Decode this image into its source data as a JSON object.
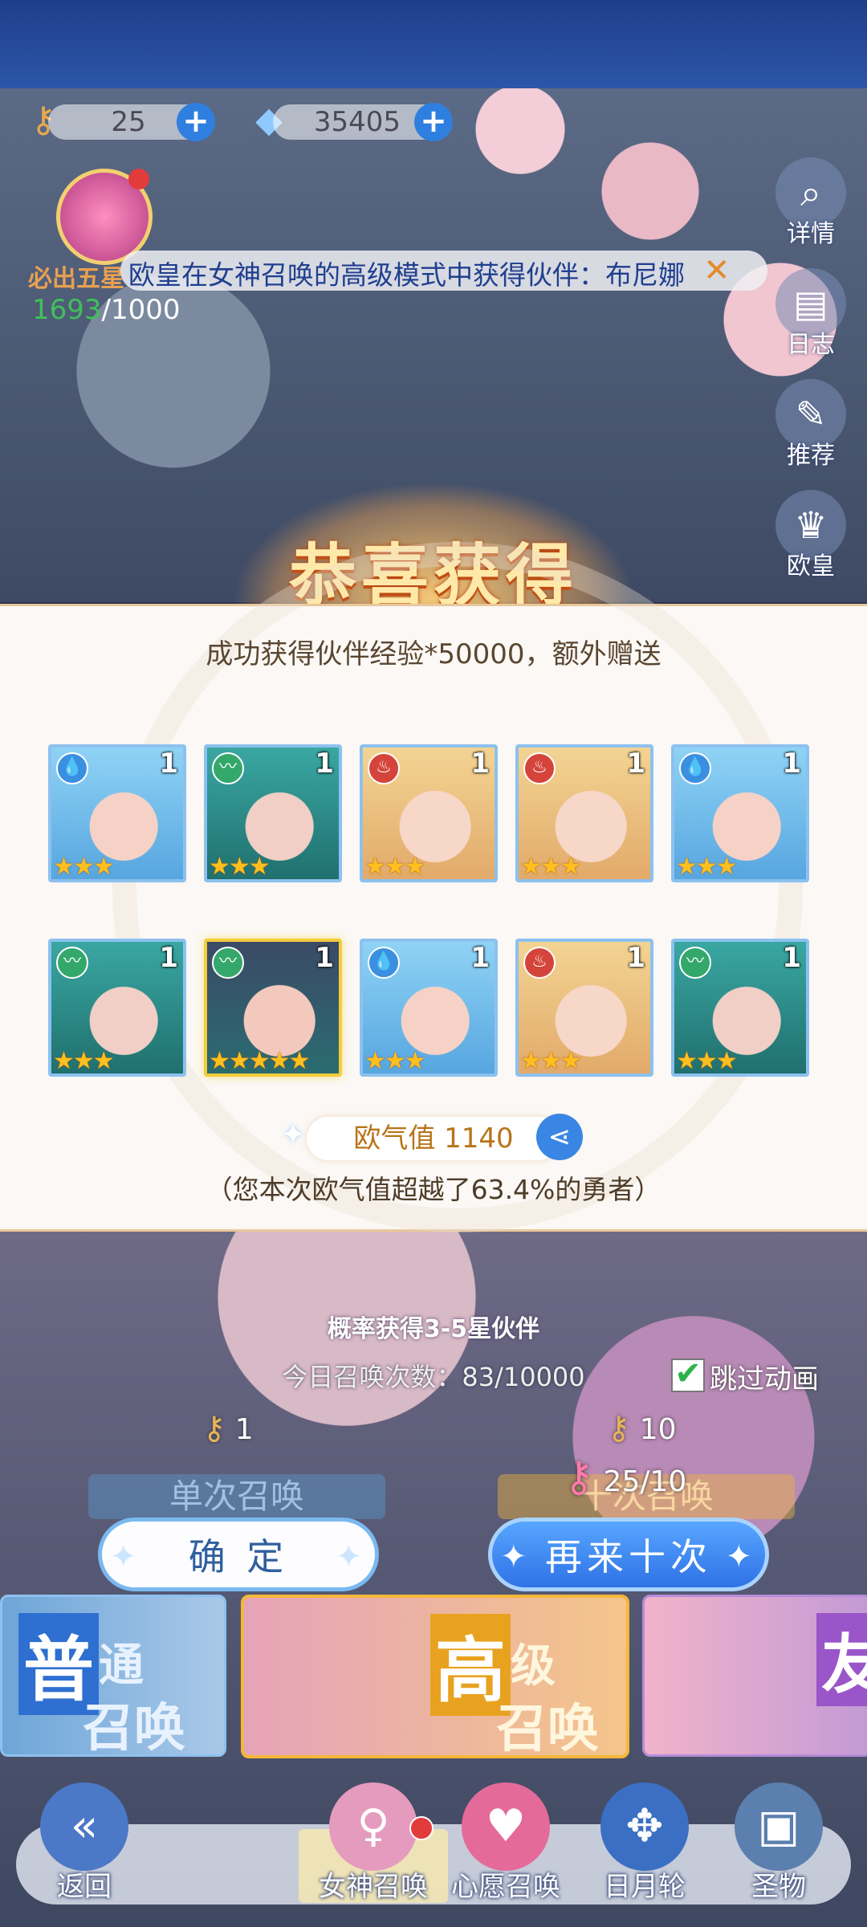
{
  "currency": {
    "tickets": "25",
    "crystals": "35405",
    "plus": "+"
  },
  "badge": {
    "label": "必出五星",
    "current": "1693",
    "total": "/1000"
  },
  "marquee": {
    "text": "欧皇在女神召唤的高级模式中获得伙伴：布尼娜",
    "close": "✕"
  },
  "side_menu": [
    "详情",
    "日志",
    "推荐",
    "欧皇"
  ],
  "congrats_title": "恭喜获得",
  "gain_text": "成功获得伙伴经验*50000，额外赠送",
  "cards": [
    {
      "element": "water",
      "portrait": "blue",
      "level": "1",
      "stars": 3
    },
    {
      "element": "wind",
      "portrait": "teal",
      "level": "1",
      "stars": 3
    },
    {
      "element": "fire",
      "portrait": "blonde",
      "level": "1",
      "stars": 3
    },
    {
      "element": "fire",
      "portrait": "blonde",
      "level": "1",
      "stars": 3
    },
    {
      "element": "water",
      "portrait": "blue",
      "level": "1",
      "stars": 3
    },
    {
      "element": "wind",
      "portrait": "teal",
      "level": "1",
      "stars": 3
    },
    {
      "element": "wind",
      "portrait": "dark",
      "level": "1",
      "stars": 5,
      "gold": true
    },
    {
      "element": "water",
      "portrait": "blue",
      "level": "1",
      "stars": 3
    },
    {
      "element": "fire",
      "portrait": "blonde",
      "level": "1",
      "stars": 3
    },
    {
      "element": "wind",
      "portrait": "teal",
      "level": "1",
      "stars": 3
    }
  ],
  "luck": {
    "label": "欧气值",
    "value": "1140",
    "surpass": "（您本次欧气值超越了63.4%的勇者）"
  },
  "summon": {
    "probability": "概率获得3-5星伙伴",
    "today": "今日召唤次数：83/10000",
    "skip_label": "跳过动画",
    "skip_checked": true,
    "single_cost": "1",
    "ten_cost": "10",
    "ticket_count": "25/10",
    "single_label": "单次召唤",
    "ten_label": "十次召唤"
  },
  "buttons": {
    "confirm": "确 定",
    "again": "再来十次"
  },
  "modes": {
    "normal_a": "普",
    "normal_b": "通",
    "normal_c": "召唤",
    "adv_a": "高",
    "adv_b": "级",
    "adv_c": "召唤",
    "third": "友"
  },
  "nav": [
    "返回",
    "女神召唤",
    "心愿召唤",
    "日月轮",
    "圣物"
  ]
}
